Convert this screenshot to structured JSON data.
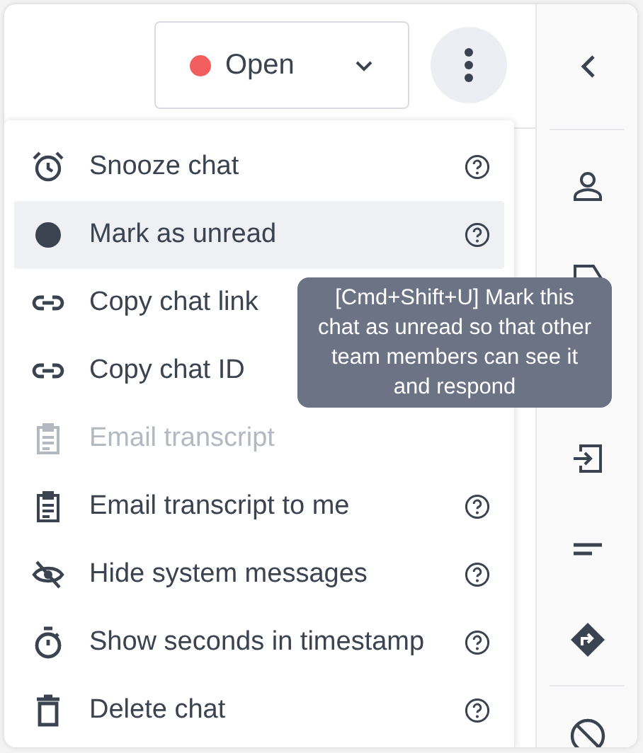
{
  "status_dropdown": {
    "label": "Open"
  },
  "menu": {
    "items": [
      {
        "label": "Snooze chat",
        "selected": false,
        "disabled": false,
        "help": true
      },
      {
        "label": "Mark as unread",
        "selected": true,
        "disabled": false,
        "help": true
      },
      {
        "label": "Copy chat link",
        "selected": false,
        "disabled": false,
        "help": false
      },
      {
        "label": "Copy chat ID",
        "selected": false,
        "disabled": false,
        "help": false
      },
      {
        "label": "Email transcript",
        "selected": false,
        "disabled": true,
        "help": false
      },
      {
        "label": "Email transcript to me",
        "selected": false,
        "disabled": false,
        "help": true
      },
      {
        "label": "Hide system messages",
        "selected": false,
        "disabled": false,
        "help": true
      },
      {
        "label": "Show seconds in timestamp",
        "selected": false,
        "disabled": false,
        "help": true
      },
      {
        "label": "Delete chat",
        "selected": false,
        "disabled": false,
        "help": true
      }
    ]
  },
  "tooltip": {
    "text": "[Cmd+Shift+U] Mark this chat as unread so that other team members can see it and respond"
  }
}
